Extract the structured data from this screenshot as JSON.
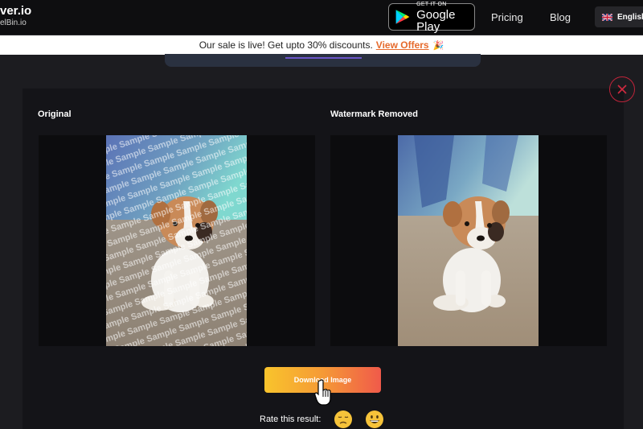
{
  "header": {
    "logo_main": "ver.io",
    "logo_sub": "elBin.io",
    "store": {
      "small": "GET IT ON",
      "big": "Google Play"
    },
    "nav": {
      "pricing": "Pricing",
      "blog": "Blog"
    },
    "language": "English"
  },
  "banner": {
    "text": "Our sale is live! Get upto 30% discounts.",
    "link": "View Offers",
    "emoji": "🎉"
  },
  "modal": {
    "original_label": "Original",
    "removed_label": "Watermark Removed",
    "watermark_word": "Sample",
    "download_label": "Download Image",
    "rate_label": "Rate this result:"
  },
  "colors": {
    "accent": "#e66a2c",
    "close": "#c0243a",
    "button_start": "#f9c42c",
    "button_end": "#f05a4a"
  }
}
